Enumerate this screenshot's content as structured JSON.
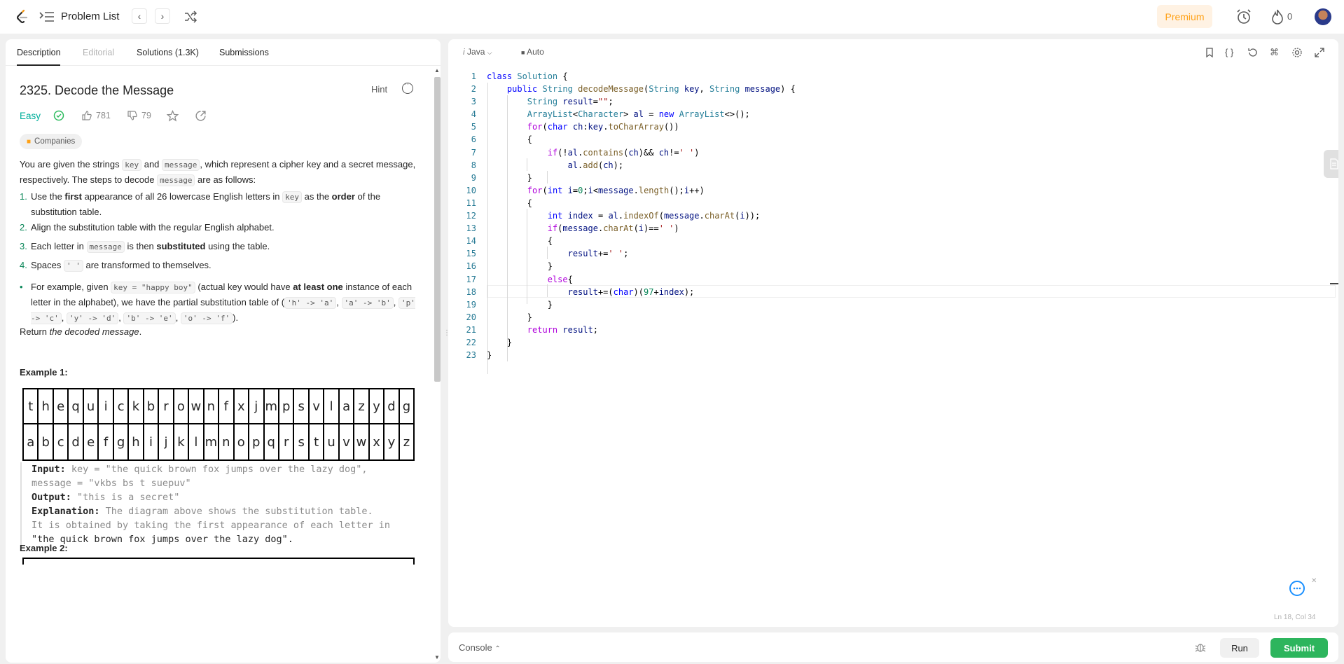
{
  "nav": {
    "problem_list": "Problem List",
    "premium": "Premium",
    "streak": "0"
  },
  "tabs": [
    {
      "label": "Description"
    },
    {
      "label": "Editorial"
    },
    {
      "label": "Solutions (1.3K)"
    },
    {
      "label": "Submissions"
    }
  ],
  "problem": {
    "title": "2325. Decode the Message",
    "hint": "Hint",
    "difficulty": "Easy",
    "likes": "781",
    "dislikes": "79",
    "companies": "Companies"
  },
  "desc": {
    "p1_a": "You are given the strings ",
    "p1_key": "key",
    "p1_b": " and ",
    "p1_msg": "message",
    "p1_c": ", which represent a cipher key and a secret message, respectively. The steps to decode ",
    "p1_msg2": "message",
    "p1_d": " are as follows:",
    "s1_num": "1.",
    "s1_a": "Use the ",
    "s1_b": "first",
    "s1_c": " appearance of all 26 lowercase English letters in ",
    "s1_key": "key",
    "s1_d": " as the ",
    "s1_e": "order",
    "s1_f": " of the substitution table.",
    "s2_num": "2.",
    "s2": "Align the substitution table with the regular English alphabet.",
    "s3_num": "3.",
    "s3_a": "Each letter in ",
    "s3_msg": "message",
    "s3_b": " is then ",
    "s3_c": "substituted",
    "s3_d": " using the table.",
    "s4_num": "4.",
    "s4_a": "Spaces ",
    "s4_code": "' '",
    "s4_b": " are transformed to themselves.",
    "bullet_a": "For example, given ",
    "bullet_code": "key = \"happy boy\"",
    "bullet_b": " (actual key would have ",
    "bullet_c": "at least one",
    "bullet_d": " instance of each letter in the alphabet), we have the partial substitution table of (",
    "map1": "'h' -> 'a'",
    "map2": "'a' -> 'b'",
    "map3": "'p' -> 'c'",
    "map4": "'y' -> 'd'",
    "map5": "'b' -> 'e'",
    "map6": "'o' -> 'f'",
    "bullet_e": ").",
    "ret_a": "Return ",
    "ret_b": "the decoded message",
    "ret_c": "."
  },
  "example1": {
    "heading": "Example 1:",
    "row1": [
      "t",
      "h",
      "e",
      "q",
      "u",
      "i",
      "c",
      "k",
      "b",
      "r",
      "o",
      "w",
      "n",
      "f",
      "x",
      "j",
      "m",
      "p",
      "s",
      "v",
      "l",
      "a",
      "z",
      "y",
      "d",
      "g"
    ],
    "row2": [
      "a",
      "b",
      "c",
      "d",
      "e",
      "f",
      "g",
      "h",
      "i",
      "j",
      "k",
      "l",
      "m",
      "n",
      "o",
      "p",
      "q",
      "r",
      "s",
      "t",
      "u",
      "v",
      "w",
      "x",
      "y",
      "z"
    ],
    "input_label": "Input:",
    "input_val": " key = \"the quick brown fox jumps over the lazy dog\",",
    "input_val2": "message = \"vkbs bs t suepuv\"",
    "output_label": "Output:",
    "output_val": " \"this is a secret\"",
    "expl_label": "Explanation:",
    "expl_val": " The diagram above shows the substitution table.",
    "expl_val2": "It is obtained by taking the first appearance of each letter in",
    "expl_val3": "\"the quick brown fox jumps over the lazy dog\"."
  },
  "example2": {
    "heading": "Example 2:"
  },
  "editor": {
    "language": "Java",
    "mode": "Auto",
    "cursor": "Ln 18, Col 34"
  },
  "console": {
    "label": "Console",
    "run": "Run",
    "submit": "Submit"
  }
}
